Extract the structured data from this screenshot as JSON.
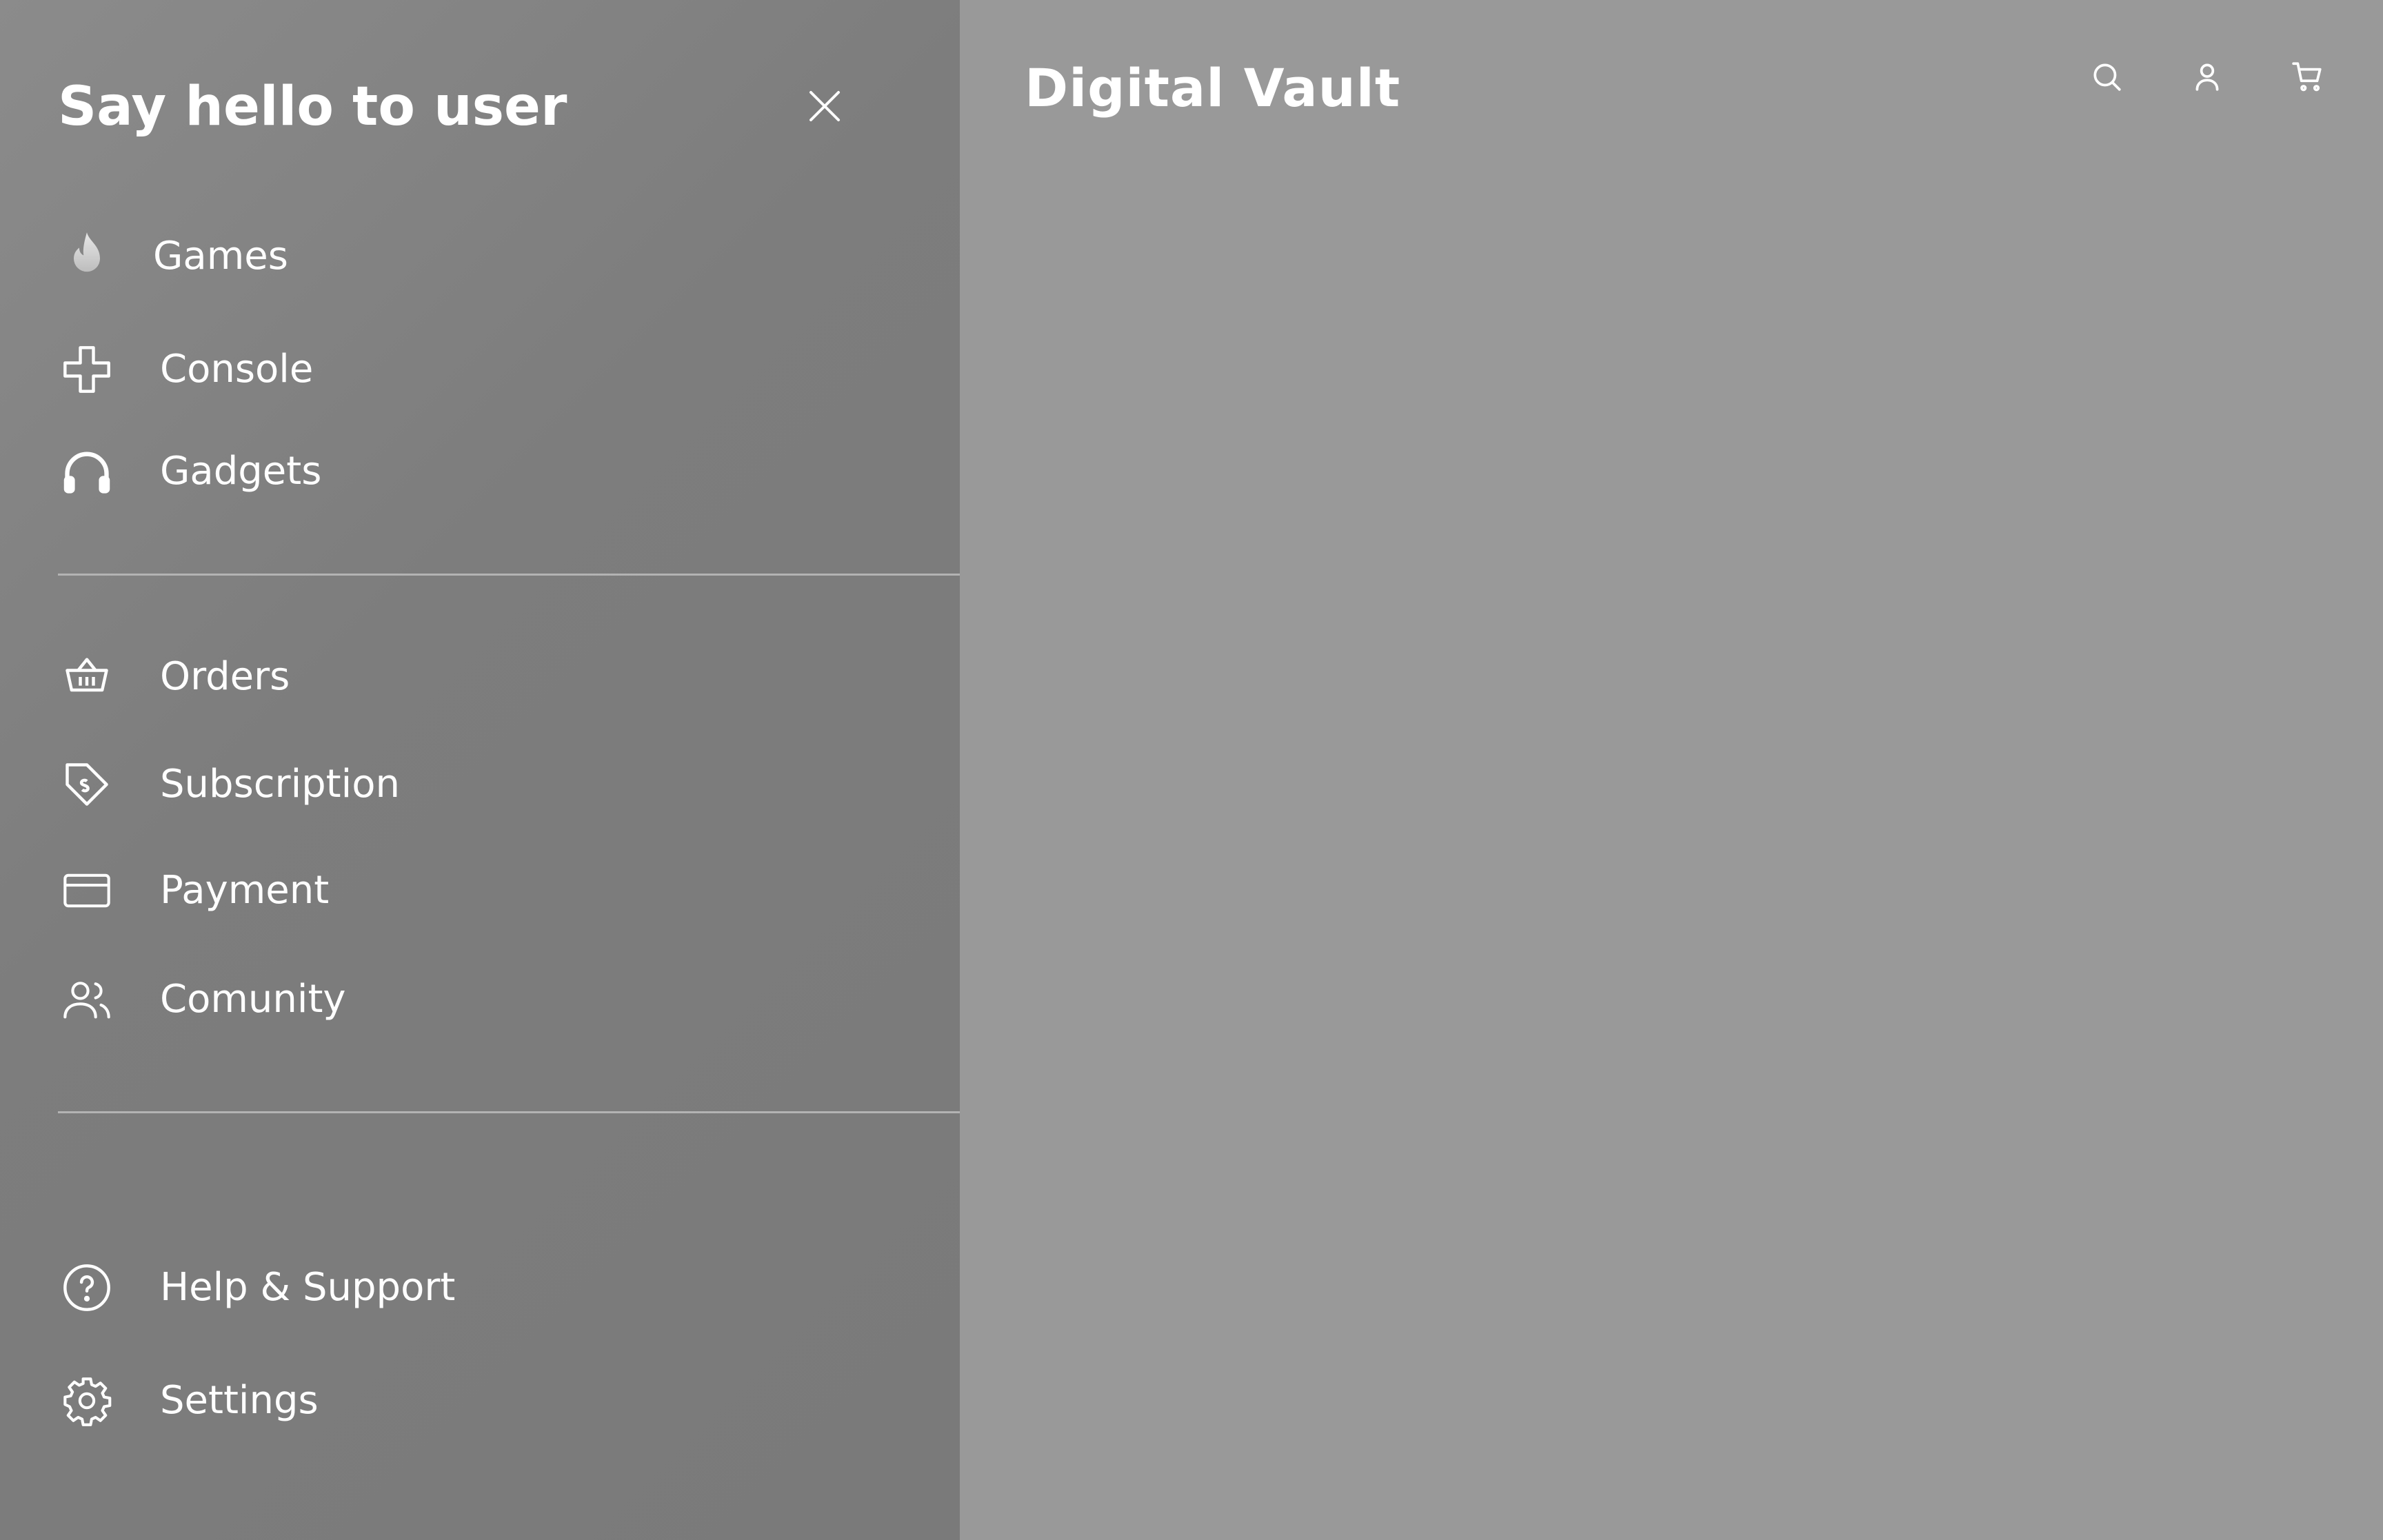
{
  "app": {
    "logo_text": "Digital Vault"
  },
  "header": {
    "icons": [
      "search-icon",
      "user-icon",
      "cart-icon"
    ]
  },
  "drawer": {
    "title": "Say hello to user",
    "close_icon": "close-icon",
    "primary_items": [
      {
        "label": "Games",
        "icon": "flame-icon"
      },
      {
        "label": "Console",
        "icon": "dpad-icon"
      },
      {
        "label": "Gadgets",
        "icon": "headphones-icon"
      }
    ],
    "secondary_items": [
      {
        "label": "Orders",
        "icon": "basket-icon"
      },
      {
        "label": "Subscription",
        "icon": "tag-icon"
      },
      {
        "label": "Payment",
        "icon": "credit-card-icon"
      },
      {
        "label": "Comunity",
        "icon": "users-icon"
      }
    ],
    "footer_items": [
      {
        "label": "Help & Support",
        "icon": "help-circle-icon"
      },
      {
        "label": "Settings",
        "icon": "gear-icon"
      }
    ]
  },
  "colors": {
    "drawer_bg": "#7d7d7d",
    "page_bg": "#999999",
    "text": "#ffffff",
    "divider": "#b3b3b3"
  }
}
